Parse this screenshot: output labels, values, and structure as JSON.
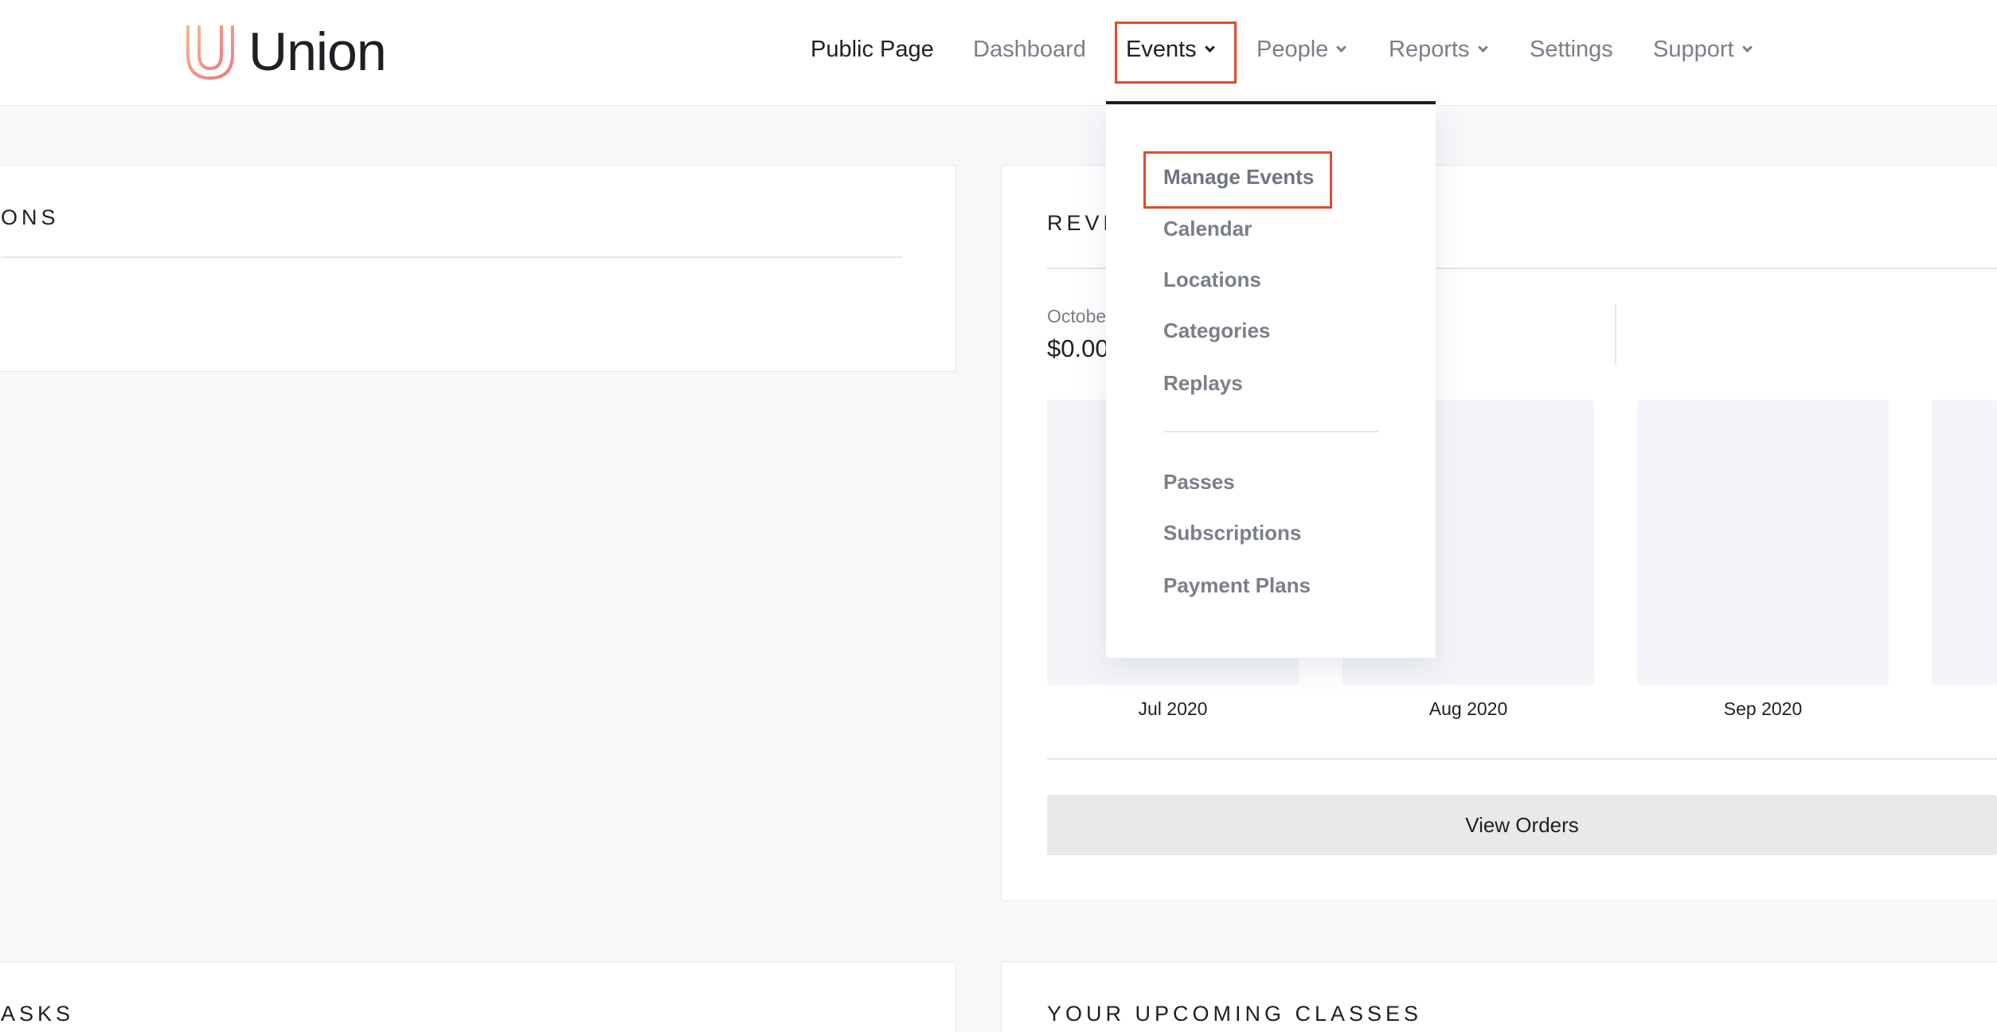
{
  "brand": {
    "name": "Union",
    "logo_icon": "union-logo-icon",
    "logo_colors": [
      "#f2b98a",
      "#ec7a84"
    ]
  },
  "nav": {
    "items": [
      {
        "label": "Public Page",
        "has_dropdown": false
      },
      {
        "label": "Dashboard",
        "has_dropdown": false
      },
      {
        "label": "Events",
        "has_dropdown": true,
        "active": true
      },
      {
        "label": "People",
        "has_dropdown": true
      },
      {
        "label": "Reports",
        "has_dropdown": true
      },
      {
        "label": "Settings",
        "has_dropdown": false
      },
      {
        "label": "Support",
        "has_dropdown": true
      }
    ]
  },
  "events_menu": {
    "group1": [
      "Manage Events",
      "Calendar",
      "Locations",
      "Categories",
      "Replays"
    ],
    "group2": [
      "Passes",
      "Subscriptions",
      "Payment Plans"
    ],
    "highlighted": "Manage Events"
  },
  "left_card": {
    "title_fragment": "ONS"
  },
  "revenue": {
    "title_fragment": "REVE",
    "subtitle_fragment": "Octobe",
    "amount_fragment": "$0.00",
    "months": [
      "Jul 2020",
      "Aug 2020",
      "Sep 2020"
    ],
    "view_orders_label": "View Orders"
  },
  "bottom": {
    "left_title_fragment": "ASKS",
    "right_title": "YOUR UPCOMING CLASSES"
  },
  "colors": {
    "highlight": "#e34a2e",
    "text_dark": "#1f2024",
    "text_muted": "#7a7f88",
    "background": "#f7f8fa"
  }
}
